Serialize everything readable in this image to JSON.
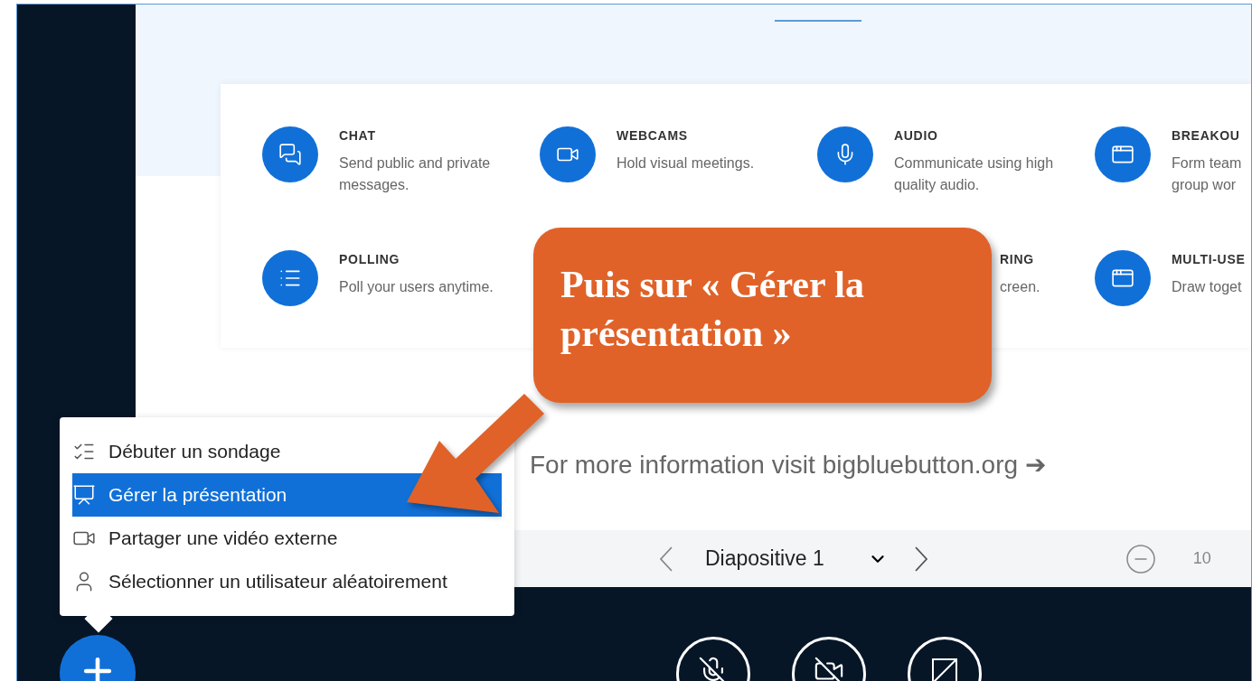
{
  "features": [
    {
      "kind": "chat",
      "title": "CHAT",
      "description": "Send public and private messages."
    },
    {
      "kind": "webcam",
      "title": "WEBCAMS",
      "description": "Hold visual meetings."
    },
    {
      "kind": "audio",
      "title": "AUDIO",
      "description": "Communicate using high quality audio."
    },
    {
      "kind": "breakout",
      "title": "BREAKOU",
      "description": "Form team group wor"
    },
    {
      "kind": "polling",
      "title": "POLLING",
      "description": "Poll your users anytime."
    },
    {
      "kind": "covered"
    },
    {
      "kind": "covered-partial",
      "title": "RING",
      "description": "creen."
    },
    {
      "kind": "whiteboard",
      "title": "MULTI-USE",
      "description": "Draw toget"
    }
  ],
  "more_info": "For more information visit bigbluebutton.org ➔",
  "slide_toolbar": {
    "slide": "Diapositive 1",
    "zoom": "10"
  },
  "actions_menu": {
    "items": [
      {
        "kind": "poll",
        "label": "Débuter un sondage",
        "selected": false
      },
      {
        "kind": "presentation",
        "label": "Gérer la présentation",
        "selected": true
      },
      {
        "kind": "video",
        "label": "Partager une vidéo externe",
        "selected": false
      },
      {
        "kind": "user",
        "label": "Sélectionner un utilisateur aléatoirement",
        "selected": false
      }
    ]
  },
  "callout": "Puis sur « Gérer la présentation »"
}
